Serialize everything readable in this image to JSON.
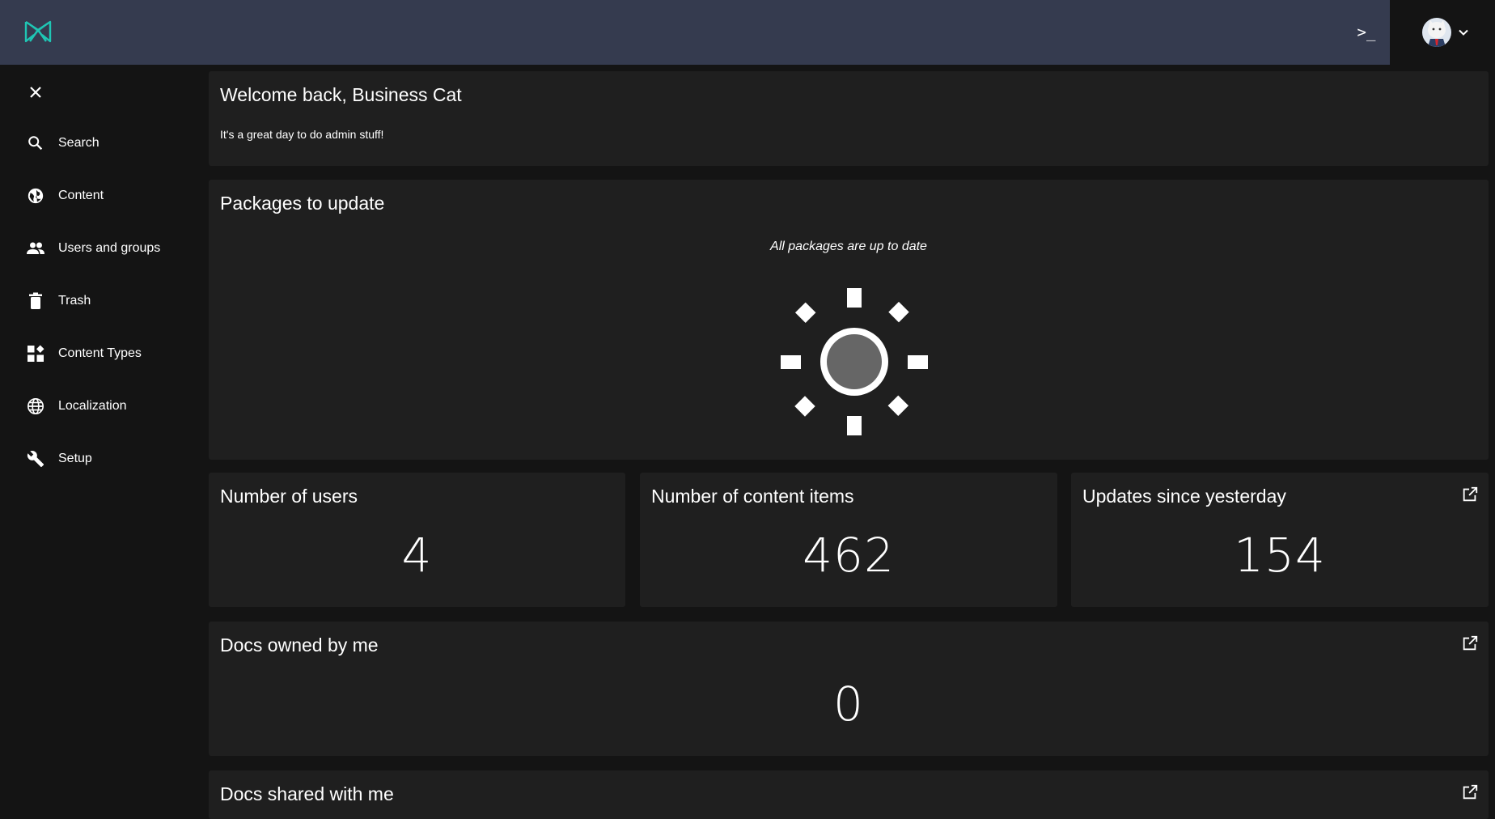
{
  "header": {
    "logo_icon": "app-logo-icon",
    "terminal_icon": "terminal-icon",
    "terminal_label": ">_",
    "user_menu_icon": "chevron-down-icon",
    "accent_color": "#1fc6b4"
  },
  "sidebar": {
    "close_icon": "close-icon",
    "items": [
      {
        "label": "Search",
        "icon": "search-icon"
      },
      {
        "label": "Content",
        "icon": "globe-icon"
      },
      {
        "label": "Users and groups",
        "icon": "people-icon"
      },
      {
        "label": "Trash",
        "icon": "trash-icon"
      },
      {
        "label": "Content Types",
        "icon": "widgets-icon"
      },
      {
        "label": "Localization",
        "icon": "language-icon"
      },
      {
        "label": "Setup",
        "icon": "wrench-icon"
      }
    ]
  },
  "welcome": {
    "title": "Welcome back, Business Cat",
    "subtitle": "It's a great day to do admin stuff!"
  },
  "packages": {
    "title": "Packages to update",
    "status": "All packages are up to date",
    "status_icon": "sun-icon"
  },
  "stats": {
    "users": {
      "title": "Number of users",
      "value": "4"
    },
    "content_items": {
      "title": "Number of content items",
      "value": "462"
    },
    "updates": {
      "title": "Updates since yesterday",
      "value": "154",
      "link_icon": "open-in-new-icon"
    }
  },
  "docs_owned": {
    "title": "Docs owned by me",
    "value": "0",
    "link_icon": "open-in-new-icon"
  },
  "docs_shared": {
    "title": "Docs shared with me",
    "link_icon": "open-in-new-icon"
  }
}
